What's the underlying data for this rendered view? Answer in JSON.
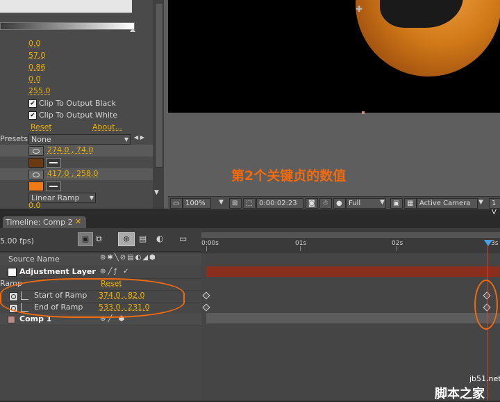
{
  "effect_controls": {
    "values": [
      "0.0",
      "57.0",
      "0.86",
      "0.0",
      "255.0"
    ],
    "clip_black_label": "Clip To Output Black",
    "clip_white_label": "Clip To Output White",
    "reset_label": "Reset",
    "about_label": "About...",
    "presets_label": "Presets:",
    "presets_value": "None",
    "start_of_ramp_value": "274.0 , 74.0",
    "start_color": "#6b3a10",
    "end_of_ramp_value": "417.0 , 258.0",
    "end_color": "#f07a14",
    "ramp_shape_value": "Linear Ramp",
    "last_value": "0.0"
  },
  "viewer_toolbar": {
    "zoom": "100%",
    "timecode": "0:00:02:23",
    "resolution": "Full",
    "camera": "Active Camera",
    "views": "1 V"
  },
  "annotation": "第2个关键贞的数值",
  "timeline": {
    "tab_title": "Timeline: Comp 2",
    "fps": "5.00 fps)",
    "source_name_header": "Source Name",
    "ruler_labels": [
      "0:00s",
      "01s",
      "02s",
      "3s"
    ],
    "layers": [
      {
        "name": "Adjustment Layer"
      },
      {
        "name": "Comp 1"
      }
    ],
    "effect_name": "Ramp",
    "effect_reset": "Reset",
    "properties": [
      {
        "name": "Start of Ramp",
        "value": "374.0 , 82.0"
      },
      {
        "name": "End of Ramp",
        "value": "533.0 , 231.0"
      }
    ]
  },
  "watermark": {
    "site": "jb51.net",
    "title": "脚本之家"
  },
  "colors": {
    "accent_value": "#f0b400",
    "annotation": "#f06a10",
    "layer_bar": "#8a2e1e",
    "cti": "#e03a2a"
  }
}
